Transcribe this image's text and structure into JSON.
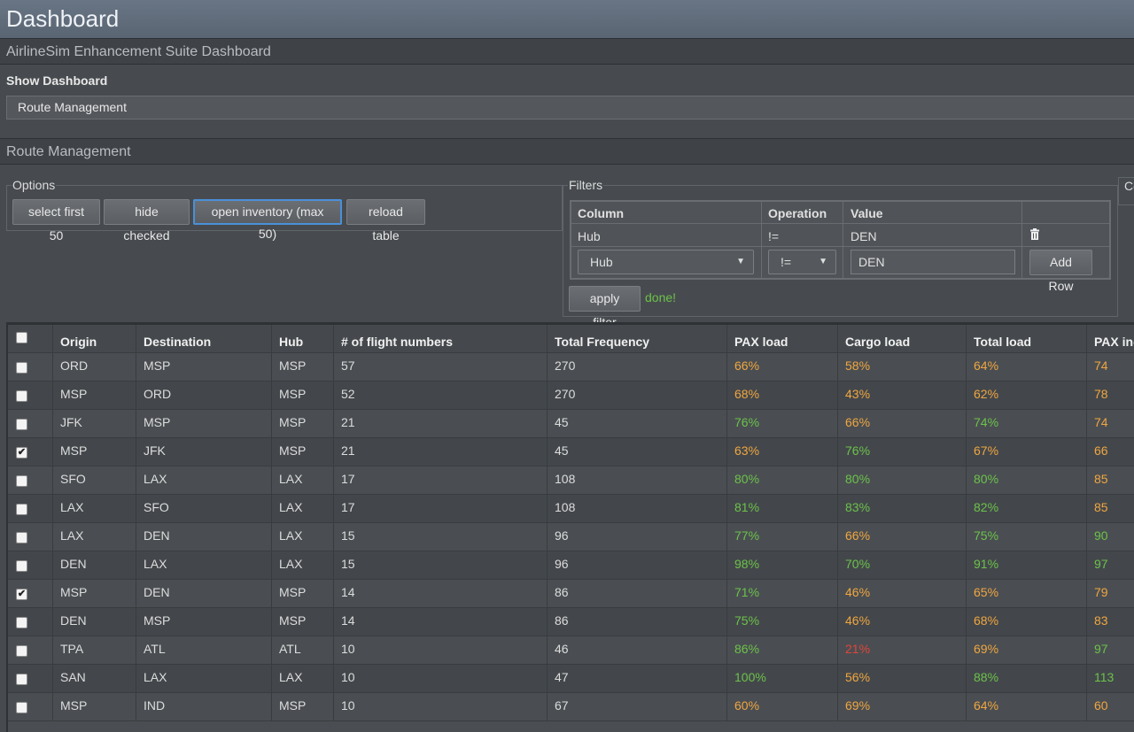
{
  "header": {
    "title": "Dashboard"
  },
  "suite": {
    "title": "AirlineSim Enhancement Suite Dashboard"
  },
  "show_dashboard": {
    "label": "Show Dashboard",
    "selected": "Route Management"
  },
  "route_mgmt": {
    "title": "Route Management"
  },
  "options": {
    "legend": "Options",
    "buttons": [
      "select first 50",
      "hide checked",
      "open inventory (max 50)",
      "reload table"
    ]
  },
  "filters": {
    "legend": "Filters",
    "headers": [
      "Column",
      "Operation",
      "Value"
    ],
    "rows": [
      {
        "column": "Hub",
        "operation": "!=",
        "value": "DEN"
      }
    ],
    "new_row": {
      "column": "Hub",
      "operation": "!=",
      "value": "DEN"
    },
    "add_row_label": "Add Row",
    "apply_label": "apply filter",
    "status": "done!"
  },
  "right_box": {
    "legend": "Co"
  },
  "table": {
    "headers": [
      "Origin",
      "Destination",
      "Hub",
      "# of flight numbers",
      "Total Frequency",
      "PAX load",
      "Cargo load",
      "Total load",
      "PAX ind"
    ],
    "rows": [
      {
        "checked": false,
        "origin": "ORD",
        "dest": "MSP",
        "hub": "MSP",
        "flights": "57",
        "freq": "270",
        "pax": "66%",
        "pax_c": "o",
        "cargo": "58%",
        "cargo_c": "o",
        "total": "64%",
        "total_c": "o",
        "paxi": "74",
        "paxi_c": "o"
      },
      {
        "checked": false,
        "origin": "MSP",
        "dest": "ORD",
        "hub": "MSP",
        "flights": "52",
        "freq": "270",
        "pax": "68%",
        "pax_c": "o",
        "cargo": "43%",
        "cargo_c": "o",
        "total": "62%",
        "total_c": "o",
        "paxi": "78",
        "paxi_c": "o"
      },
      {
        "checked": false,
        "origin": "JFK",
        "dest": "MSP",
        "hub": "MSP",
        "flights": "21",
        "freq": "45",
        "pax": "76%",
        "pax_c": "g",
        "cargo": "66%",
        "cargo_c": "o",
        "total": "74%",
        "total_c": "g",
        "paxi": "74",
        "paxi_c": "o"
      },
      {
        "checked": true,
        "origin": "MSP",
        "dest": "JFK",
        "hub": "MSP",
        "flights": "21",
        "freq": "45",
        "pax": "63%",
        "pax_c": "o",
        "cargo": "76%",
        "cargo_c": "g",
        "total": "67%",
        "total_c": "o",
        "paxi": "66",
        "paxi_c": "o"
      },
      {
        "checked": false,
        "origin": "SFO",
        "dest": "LAX",
        "hub": "LAX",
        "flights": "17",
        "freq": "108",
        "pax": "80%",
        "pax_c": "g",
        "cargo": "80%",
        "cargo_c": "g",
        "total": "80%",
        "total_c": "g",
        "paxi": "85",
        "paxi_c": "o"
      },
      {
        "checked": false,
        "origin": "LAX",
        "dest": "SFO",
        "hub": "LAX",
        "flights": "17",
        "freq": "108",
        "pax": "81%",
        "pax_c": "g",
        "cargo": "83%",
        "cargo_c": "g",
        "total": "82%",
        "total_c": "g",
        "paxi": "85",
        "paxi_c": "o"
      },
      {
        "checked": false,
        "origin": "LAX",
        "dest": "DEN",
        "hub": "LAX",
        "flights": "15",
        "freq": "96",
        "pax": "77%",
        "pax_c": "g",
        "cargo": "66%",
        "cargo_c": "o",
        "total": "75%",
        "total_c": "g",
        "paxi": "90",
        "paxi_c": "g"
      },
      {
        "checked": false,
        "origin": "DEN",
        "dest": "LAX",
        "hub": "LAX",
        "flights": "15",
        "freq": "96",
        "pax": "98%",
        "pax_c": "g",
        "cargo": "70%",
        "cargo_c": "g",
        "total": "91%",
        "total_c": "g",
        "paxi": "97",
        "paxi_c": "g"
      },
      {
        "checked": true,
        "origin": "MSP",
        "dest": "DEN",
        "hub": "MSP",
        "flights": "14",
        "freq": "86",
        "pax": "71%",
        "pax_c": "g",
        "cargo": "46%",
        "cargo_c": "o",
        "total": "65%",
        "total_c": "o",
        "paxi": "79",
        "paxi_c": "o"
      },
      {
        "checked": false,
        "origin": "DEN",
        "dest": "MSP",
        "hub": "MSP",
        "flights": "14",
        "freq": "86",
        "pax": "75%",
        "pax_c": "g",
        "cargo": "46%",
        "cargo_c": "o",
        "total": "68%",
        "total_c": "o",
        "paxi": "83",
        "paxi_c": "o"
      },
      {
        "checked": false,
        "origin": "TPA",
        "dest": "ATL",
        "hub": "ATL",
        "flights": "10",
        "freq": "46",
        "pax": "86%",
        "pax_c": "g",
        "cargo": "21%",
        "cargo_c": "r",
        "total": "69%",
        "total_c": "o",
        "paxi": "97",
        "paxi_c": "g"
      },
      {
        "checked": false,
        "origin": "SAN",
        "dest": "LAX",
        "hub": "LAX",
        "flights": "10",
        "freq": "47",
        "pax": "100%",
        "pax_c": "g",
        "cargo": "56%",
        "cargo_c": "o",
        "total": "88%",
        "total_c": "g",
        "paxi": "113",
        "paxi_c": "g"
      },
      {
        "checked": false,
        "origin": "MSP",
        "dest": "IND",
        "hub": "MSP",
        "flights": "10",
        "freq": "67",
        "pax": "60%",
        "pax_c": "o",
        "cargo": "69%",
        "cargo_c": "o",
        "total": "64%",
        "total_c": "o",
        "paxi": "60",
        "paxi_c": "o"
      }
    ]
  },
  "icons": {
    "delete": "trash-icon",
    "dropdown": "chevron-down-icon",
    "check": "check-icon"
  },
  "colors": {
    "good": "#6cc24a",
    "medium": "#f0a640",
    "bad": "#e0453a",
    "focus": "#4a90d9"
  }
}
